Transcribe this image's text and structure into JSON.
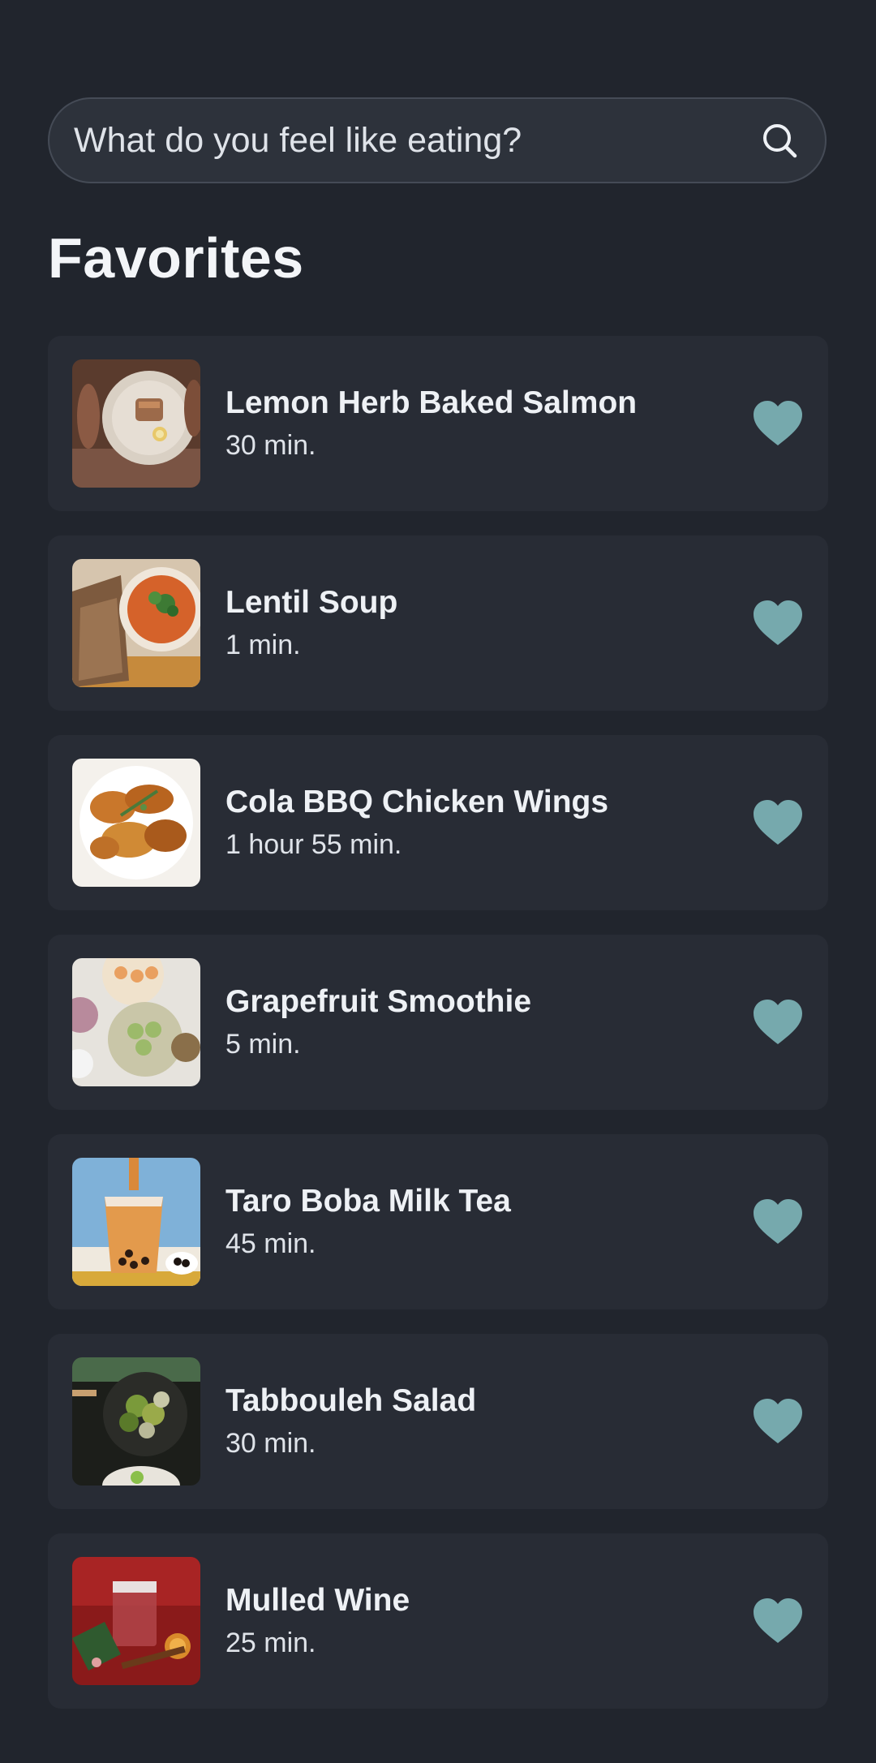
{
  "search": {
    "placeholder": "What do you feel like eating?",
    "icon": "search-icon"
  },
  "page_title": "Favorites",
  "colors": {
    "background": "#21252d",
    "card": "#282c35",
    "heart": "#76a9ad"
  },
  "recipes": [
    {
      "title": "Lemon Herb Baked Salmon",
      "time": "30 min.",
      "favorite_icon": "heart-icon"
    },
    {
      "title": "Lentil Soup",
      "time": "1 min.",
      "favorite_icon": "heart-icon"
    },
    {
      "title": "Cola BBQ Chicken Wings",
      "time": "1 hour 55 min.",
      "favorite_icon": "heart-icon"
    },
    {
      "title": "Grapefruit Smoothie",
      "time": "5 min.",
      "favorite_icon": "heart-icon"
    },
    {
      "title": "Taro Boba Milk Tea",
      "time": "45 min.",
      "favorite_icon": "heart-icon"
    },
    {
      "title": "Tabbouleh Salad",
      "time": "30 min.",
      "favorite_icon": "heart-icon"
    },
    {
      "title": "Mulled Wine",
      "time": "25 min.",
      "favorite_icon": "heart-icon"
    }
  ]
}
